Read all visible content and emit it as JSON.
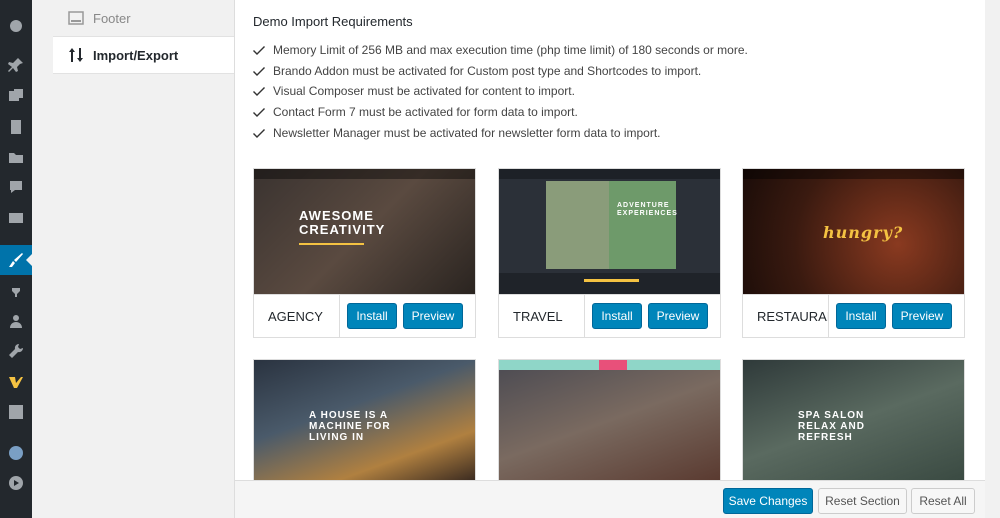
{
  "subnav": {
    "items": [
      {
        "label": "Footer",
        "icon": "footer-icon",
        "active": false
      },
      {
        "label": "Import/Export",
        "icon": "sort-arrows-icon",
        "active": true
      }
    ]
  },
  "main": {
    "heading": "Demo Import Requirements",
    "requirements": [
      "Memory Limit of 256 MB and max execution time (php time limit) of 180 seconds or more.",
      "Brando Addon must be activated for Custom post type and Shortcodes to import.",
      "Visual Composer must be activated for content to import.",
      "Contact Form 7 must be activated for form data to import.",
      "Newsletter Manager must be activated for newsletter form data to import."
    ],
    "demos": [
      {
        "name": "AGENCY",
        "install": "Install",
        "preview": "Preview",
        "thumb_text": "AWESOME\nCREATIVITY"
      },
      {
        "name": "TRAVEL",
        "install": "Install",
        "preview": "Preview",
        "thumb_text": "ADVENTURE\nEXPERIENCES"
      },
      {
        "name": "RESTAURANT",
        "install": "Install",
        "preview": "Preview",
        "thumb_text": "hungry?"
      },
      {
        "name": "",
        "thumb_text": "A HOUSE IS A\nMACHINE FOR\nLIVING IN"
      },
      {
        "name": "",
        "thumb_text": ""
      },
      {
        "name": "",
        "thumb_text": "SPA SALON\nRELAX AND\nREFRESH"
      }
    ]
  },
  "footer": {
    "save": "Save Changes",
    "reset_section": "Reset Section",
    "reset_all": "Reset All"
  },
  "colors": {
    "admin_bar": "#23282d",
    "accent": "#0085ba"
  }
}
